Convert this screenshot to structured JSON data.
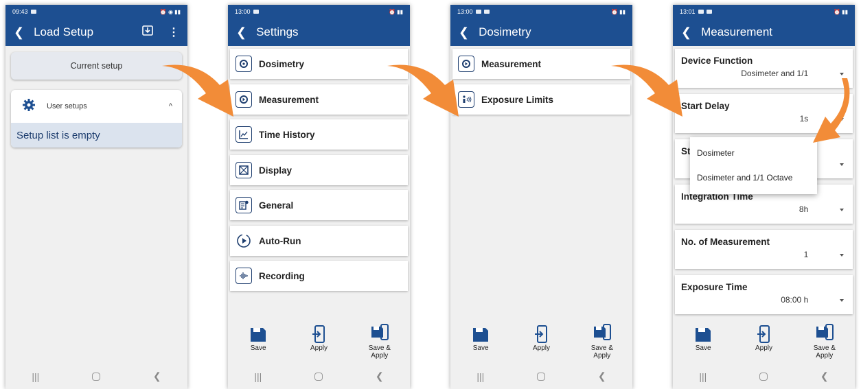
{
  "colors": {
    "primary": "#1d4f91",
    "accent": "#f28c38",
    "background": "#f0f0f0"
  },
  "screen1": {
    "time": "09:43",
    "title": "Load Setup",
    "icons": [
      "back-icon",
      "download-icon",
      "more-vert-icon"
    ],
    "current_setup_button": "Current setup",
    "user_setups_label": "User setups",
    "empty_message": "Setup list is empty"
  },
  "screen2": {
    "time": "13:00",
    "title": "Settings",
    "menu": [
      {
        "label": "Dosimetry",
        "icon": "dosimetry-icon"
      },
      {
        "label": "Measurement",
        "icon": "measurement-icon"
      },
      {
        "label": "Time History",
        "icon": "time-history-icon"
      },
      {
        "label": "Display",
        "icon": "display-icon"
      },
      {
        "label": "General",
        "icon": "general-icon"
      },
      {
        "label": "Auto-Run",
        "icon": "auto-run-icon"
      },
      {
        "label": "Recording",
        "icon": "recording-icon"
      }
    ]
  },
  "screen3": {
    "time": "13:00",
    "title": "Dosimetry",
    "menu": [
      {
        "label": "Measurement",
        "icon": "measurement-icon"
      },
      {
        "label": "Exposure Limits",
        "icon": "exposure-limits-icon"
      }
    ]
  },
  "screen4": {
    "time": "13:01",
    "title": "Measurement",
    "fields": [
      {
        "label": "Device Function",
        "value": "Dosimeter and 1/1"
      },
      {
        "label": "Start Delay",
        "value": "1s"
      },
      {
        "label": "St",
        "value": ""
      },
      {
        "label": "Integration Time",
        "value": "8h"
      },
      {
        "label": "No. of Measurement",
        "value": "1"
      },
      {
        "label": "Exposure Time",
        "value": "08:00 h"
      }
    ],
    "dropdown_options": [
      "Dosimeter",
      "Dosimeter and 1/1 Octave"
    ]
  },
  "bottom_actions": {
    "save": "Save",
    "apply": "Apply",
    "save_apply_1": "Save &",
    "save_apply_2": "Apply"
  }
}
